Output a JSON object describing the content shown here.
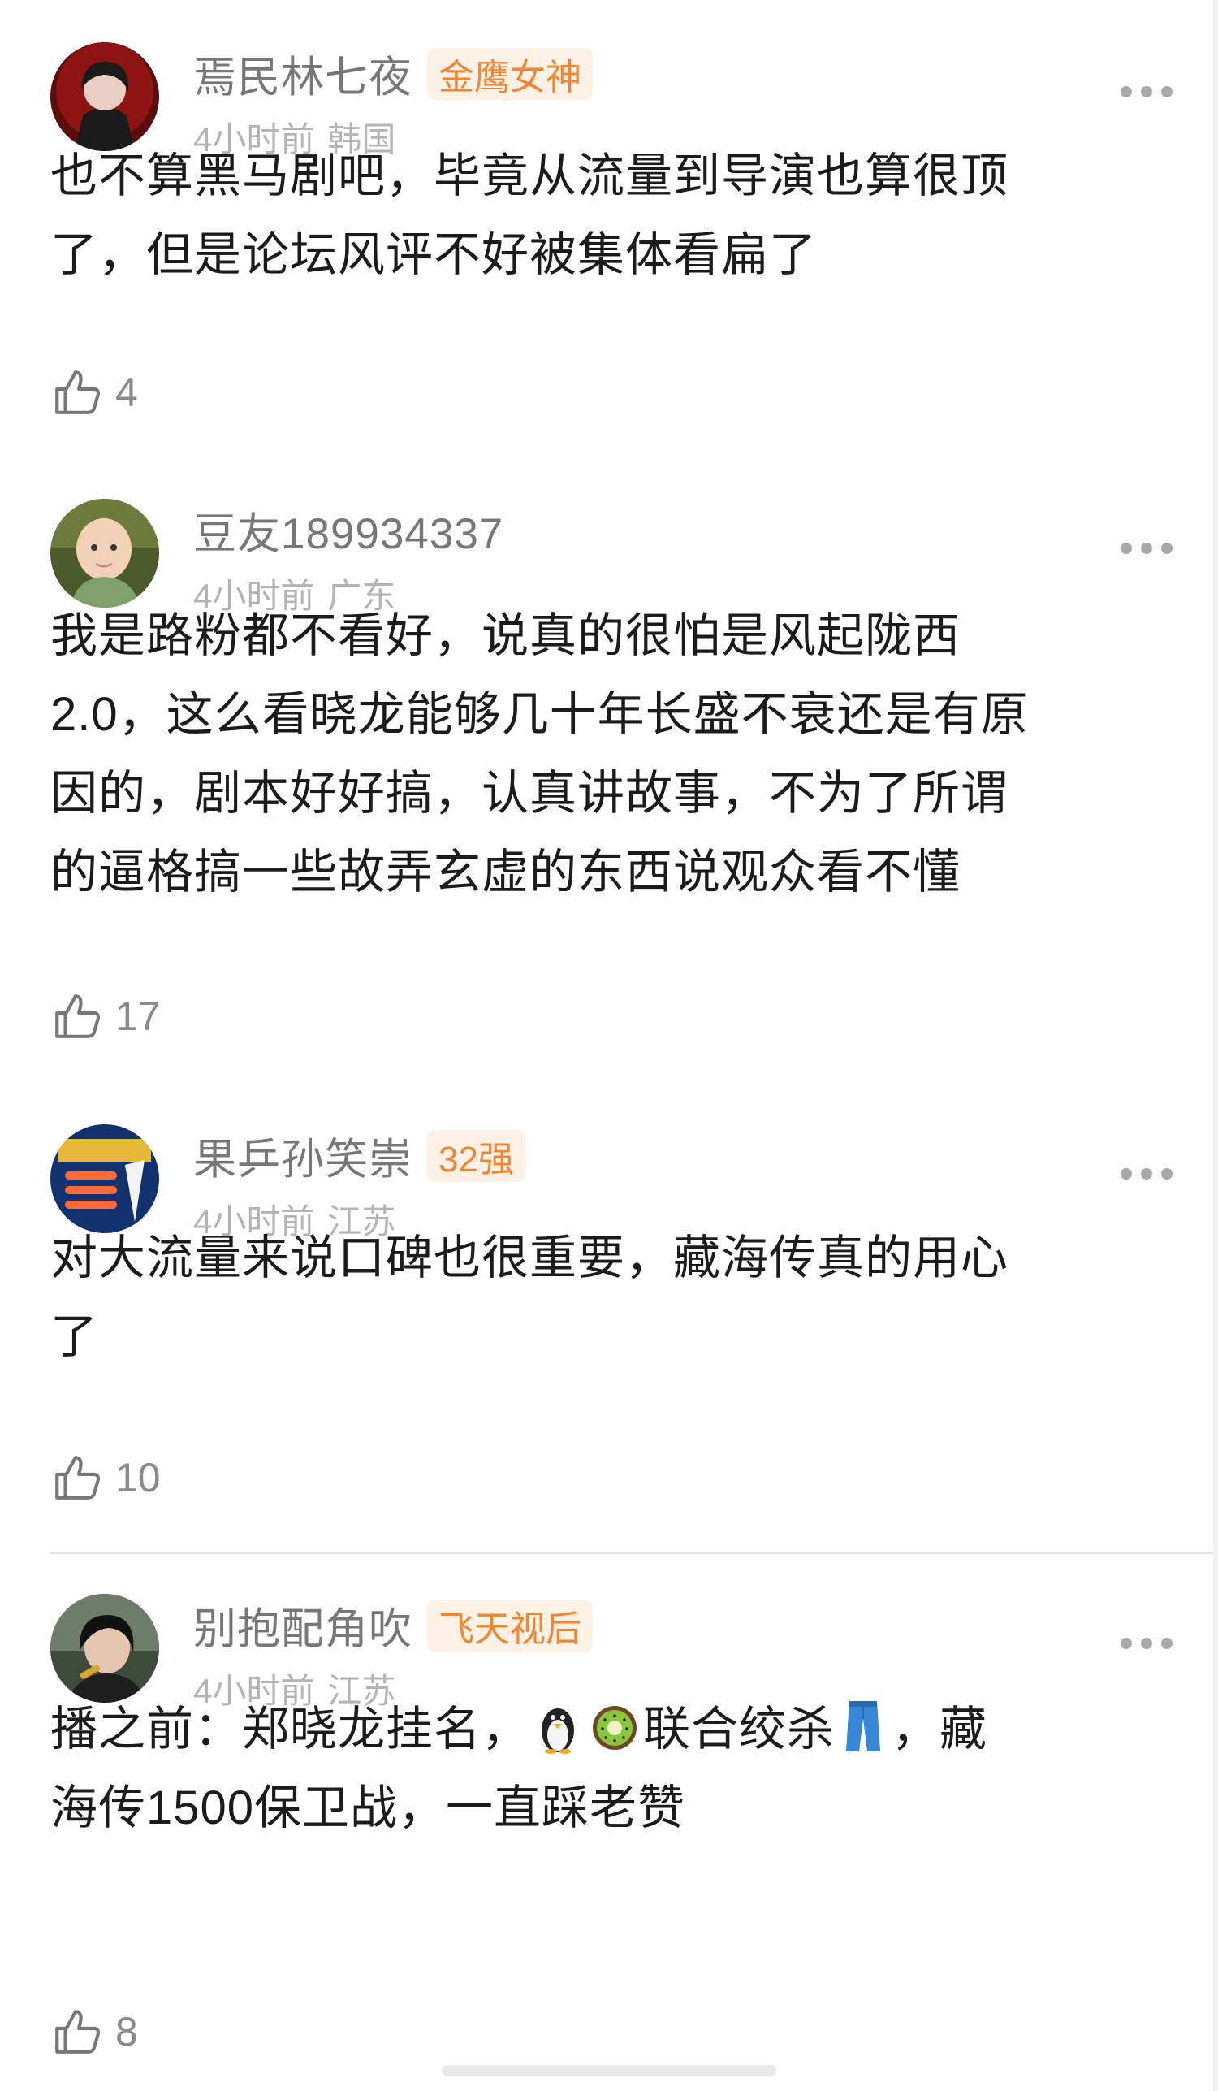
{
  "comments": [
    {
      "username": "焉民林七夜",
      "badge": "金鹰女神",
      "time": "4小时前",
      "location": "韩国",
      "text_lines": [
        "也不算黑马剧吧，毕竟从流量到导演也算很顶",
        "了，但是论坛风评不好被集体看扁了"
      ],
      "likes": "4",
      "avatar_icon": "avatar-red-dark-portrait",
      "more_icon": "more-dots-icon",
      "like_icon": "thumb-up-icon"
    },
    {
      "username": "豆友189934337",
      "badge": "",
      "time": "4小时前",
      "location": "广东",
      "text_lines": [
        "我是路粉都不看好，说真的很怕是风起陇西",
        "2.0，这么看晓龙能够几十年长盛不衰还是有原",
        "因的，剧本好好搞，认真讲故事，不为了所谓",
        "的逼格搞一些故弄玄虚的东西说观众看不懂"
      ],
      "likes": "17",
      "avatar_icon": "avatar-baby-photo",
      "more_icon": "more-dots-icon",
      "like_icon": "thumb-up-icon"
    },
    {
      "username": "果乒孙笑崇",
      "badge": "32强",
      "time": "4小时前",
      "location": "江苏",
      "text_lines": [
        "对大流量来说口碑也很重要，藏海传真的用心",
        "了"
      ],
      "likes": "10",
      "avatar_icon": "avatar-blue-promo-graphic",
      "more_icon": "more-dots-icon",
      "like_icon": "thumb-up-icon"
    },
    {
      "username": "别抱配角吹",
      "badge": "飞天视后",
      "time": "4小时前",
      "location": "江苏",
      "text_line1_a": "播之前：郑晓龙挂名，",
      "text_line1_b": "联合绞杀",
      "text_line1_c": "，藏",
      "text_line2": "海传1500保卫战，一直踩老赞",
      "emojis": [
        "penguin-emoji",
        "kiwi-emoji",
        "jeans-emoji"
      ],
      "likes": "8",
      "avatar_icon": "avatar-dark-hair-portrait",
      "more_icon": "more-dots-icon",
      "like_icon": "thumb-up-icon"
    }
  ],
  "colors": {
    "badge_text": "#ef8632",
    "badge_bg": "#fdf1e6",
    "username": "#777777",
    "meta": "#b4b4b4",
    "body": "#1b1b1b"
  }
}
